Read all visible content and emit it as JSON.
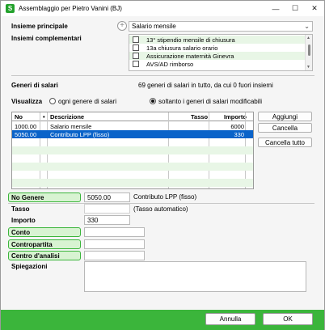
{
  "window": {
    "title": "Assemblaggio per Pietro Vanini  (BJ)",
    "minimize": "—",
    "maximize": "☐",
    "close": "✕"
  },
  "insieme_principale": {
    "label": "Insieme principale",
    "value": "Salario mensile"
  },
  "insiemi_complementari": {
    "label": "Insiemi complementari",
    "items": [
      {
        "label": "13° stipendio mensile di chiusura",
        "checked": false
      },
      {
        "label": "13a chiusura salario orario",
        "checked": false
      },
      {
        "label": "Assicurazione maternità Ginevra",
        "checked": false
      },
      {
        "label": "AVS/AD rimborso",
        "checked": false
      }
    ]
  },
  "generi": {
    "label": "Generi di salari",
    "summary": "69 generi di salari in tutto, da cui 0 fuori insiemi",
    "visualizza_label": "Visualizza",
    "radio_all": "ogni genere di salari",
    "radio_modifiable": "soltanto i generi di salari modificabili",
    "selected_radio": "modifiable"
  },
  "table": {
    "headers": {
      "no": "No",
      "flag": "•",
      "descrizione": "Descrizione",
      "tasso": "Tasso",
      "importo": "Importo"
    },
    "rows": [
      {
        "no": "1000.00",
        "descrizione": "Salario mensile",
        "tasso": "",
        "importo": "6000"
      },
      {
        "no": "5050.00",
        "descrizione": "Contributo LPP (fisso)",
        "tasso": "",
        "importo": "330"
      }
    ],
    "selected_row": 1
  },
  "buttons": {
    "aggiungi": "Aggiungi",
    "cancella": "Cancella",
    "cancella_tutto": "Cancella tutto"
  },
  "detail": {
    "no_genere_label": "No Genere",
    "no_genere_value": "5050.00",
    "no_genere_desc": "Contributo LPP (fisso)",
    "tasso_label": "Tasso",
    "tasso_value": "",
    "tasso_note": "(Tasso automatico)",
    "importo_label": "Importo",
    "importo_value": "330",
    "conto_label": "Conto",
    "contropartita_label": "Contropartita",
    "centro_label": "Centro d'analisi",
    "spiegazioni_label": "Spiegazioni"
  },
  "footer": {
    "annulla": "Annulla",
    "ok": "OK"
  },
  "colors": {
    "accent_green": "#3bb53b",
    "label_green_bg": "#d8f3d2",
    "selection_blue": "#0a63c9",
    "row_alt": "#e8f6e6"
  }
}
